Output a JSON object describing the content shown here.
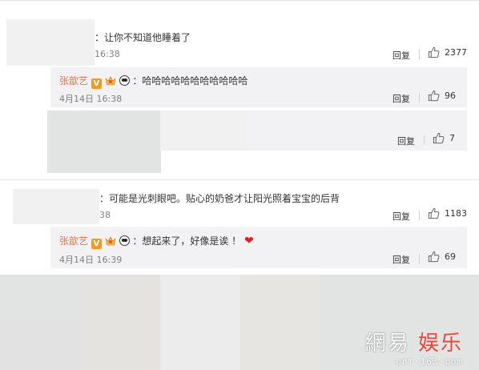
{
  "comments": [
    {
      "text": "：让你不知道他睡着了",
      "time_visible": "16:38",
      "reply_label": "回复",
      "likes": "2377"
    },
    {
      "text": "：可能是光刺眼吧。贴心的奶爸才让阳光照着宝宝的后背",
      "time_visible": "38",
      "reply_label": "回复",
      "likes": "1183"
    }
  ],
  "replies": [
    {
      "username": "张歆艺",
      "text": "：哈哈哈哈哈哈哈哈哈哈哈",
      "time": "4月14日 16:38",
      "reply_label": "回复",
      "likes": "96"
    },
    {
      "reply_label": "回复",
      "likes": "7"
    },
    {
      "username": "张歆艺",
      "text": "：想起来了，好像是诶 ！",
      "time": "4月14日 16:39",
      "reply_label": "回复",
      "likes": "69"
    }
  ],
  "badges": {
    "v_label": "V",
    "icons": [
      "verified-v-icon",
      "crown-icon",
      "panda-icon",
      "heart-icon",
      "thumbs-up-icon"
    ]
  },
  "colors": {
    "username": "#eb7350",
    "verified": "#f29c1f",
    "heart": "#e0201f",
    "reply_bg": "#f2f2f5"
  },
  "watermark": {
    "brand_a": "網易",
    "brand_b": "娱乐",
    "domain": "ent·163·com"
  }
}
